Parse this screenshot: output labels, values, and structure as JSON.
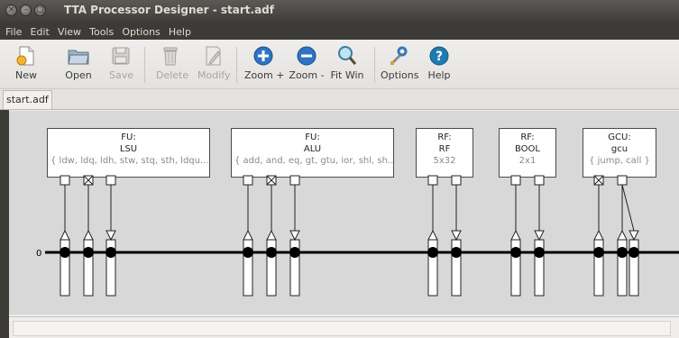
{
  "window": {
    "title": "TTA Processor Designer - start.adf"
  },
  "menu": [
    "File",
    "Edit",
    "View",
    "Tools",
    "Options",
    "Help"
  ],
  "toolbar": {
    "new": "New",
    "open": "Open",
    "save": "Save",
    "delete": "Delete",
    "modify": "Modify",
    "zoom_in": "Zoom +",
    "zoom_out": "Zoom -",
    "fit": "Fit Win",
    "options": "Options",
    "help": "Help"
  },
  "tab": {
    "label": "start.adf"
  },
  "canvas": {
    "bus_label": "0",
    "units": [
      {
        "type": "FU:",
        "name": "LSU",
        "detail": "{ ldw, ldq, ldh, stw, stq, sth, ldqu..."
      },
      {
        "type": "FU:",
        "name": "ALU",
        "detail": "{ add, and, eq, gt, gtu, ior, shl, sh..."
      },
      {
        "type": "RF:",
        "name": "RF",
        "detail": "5x32"
      },
      {
        "type": "RF:",
        "name": "BOOL",
        "detail": "2x1"
      },
      {
        "type": "GCU:",
        "name": "gcu",
        "detail": "{ jump, call }"
      }
    ]
  },
  "colors": {
    "titlebar": "#3c3b37",
    "canvas": "#d8d8d8",
    "bus": "#000000"
  }
}
